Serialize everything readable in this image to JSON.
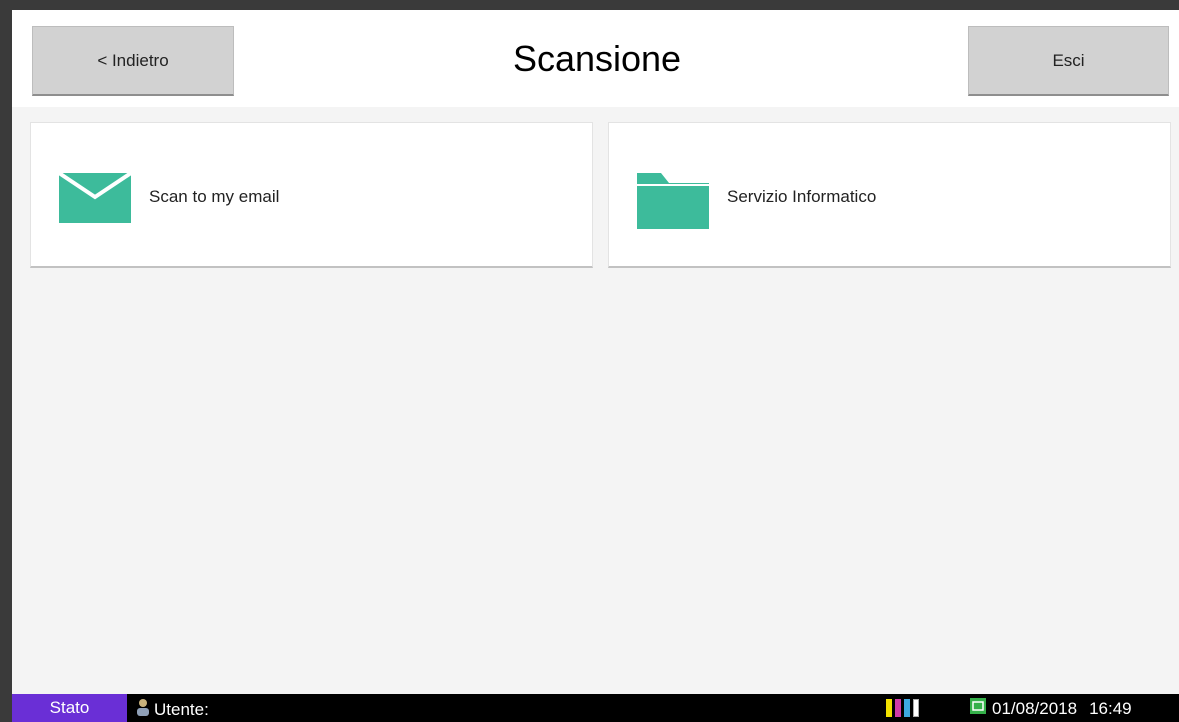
{
  "header": {
    "back_label": "< Indietro",
    "title": "Scansione",
    "exit_label": "Esci"
  },
  "tiles": [
    {
      "label": "Scan to my email",
      "icon": "envelope-icon"
    },
    {
      "label": "Servizio Informatico",
      "icon": "folder-icon"
    }
  ],
  "status_bar": {
    "stato_label": "Stato",
    "user_label": "Utente:",
    "user_value": "",
    "date": "01/08/2018",
    "time": "16:49"
  },
  "colors": {
    "accent": "#3dbb9b",
    "stato": "#6a2fd6",
    "status_bar": "#000000",
    "toner_yellow": "#f2e200",
    "toner_magenta": "#d03aa8",
    "toner_cyan": "#3da8e0",
    "toner_black": "#ffffff"
  }
}
